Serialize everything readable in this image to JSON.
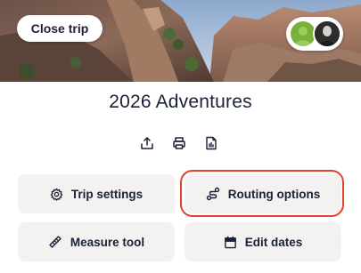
{
  "header": {
    "close_label": "Close trip",
    "avatars": [
      "avatar-green",
      "avatar-dark"
    ]
  },
  "trip": {
    "title": "2026 Adventures"
  },
  "toolbar": {
    "icons": [
      "share-icon",
      "print-icon",
      "pdf-icon"
    ]
  },
  "actions": {
    "trip_settings": "Trip settings",
    "routing_options": "Routing options",
    "measure_tool": "Measure tool",
    "edit_dates": "Edit dates"
  },
  "colors": {
    "text": "#1a2138",
    "button_bg": "#f3f2f1",
    "highlight": "#e2412b"
  }
}
